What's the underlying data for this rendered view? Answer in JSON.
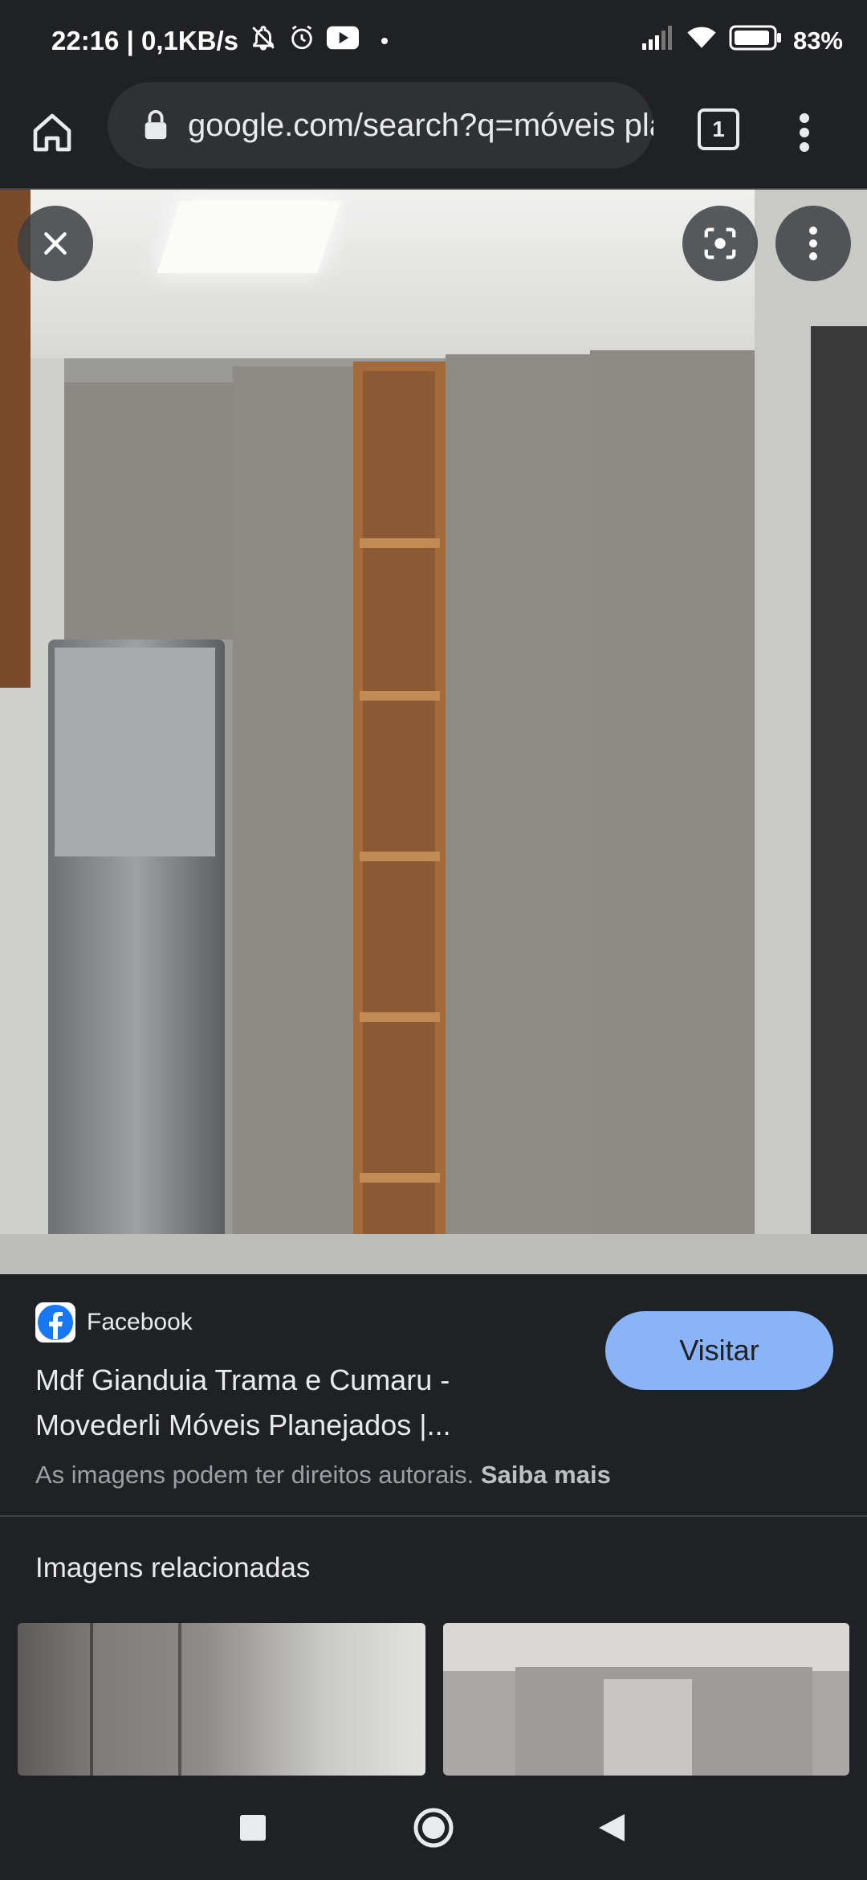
{
  "status_bar": {
    "time_speed": "22:16 | 0,1KB/s",
    "battery": "83%",
    "icons": [
      "bell-off-icon",
      "alarm-icon",
      "youtube-icon",
      "signal-icon",
      "wifi-icon",
      "battery-icon"
    ]
  },
  "toolbar": {
    "url": "google.com/search?q=móveis planejados",
    "tab_count": "1",
    "icons": [
      "home-icon",
      "lock-icon",
      "tabs-icon",
      "more-vert-icon"
    ]
  },
  "image_viewer": {
    "icons": [
      "close-icon",
      "lens-icon",
      "more-vert-icon"
    ]
  },
  "result": {
    "source": "Facebook",
    "title": "Mdf Gianduia Trama e Cumaru - Movederli Móveis Planejados |...",
    "visit_label": "Visitar",
    "copyright_text": "As imagens podem ter direitos autorais.",
    "learn_more": "Saiba mais"
  },
  "related": {
    "heading": "Imagens relacionadas"
  },
  "colors": {
    "background": "#202124",
    "visit_button": "#8ab4f8",
    "secondary_text": "#9aa0a6"
  },
  "nav_bar": {
    "icons": [
      "recents-square-icon",
      "home-circle-icon",
      "back-triangle-icon"
    ]
  }
}
